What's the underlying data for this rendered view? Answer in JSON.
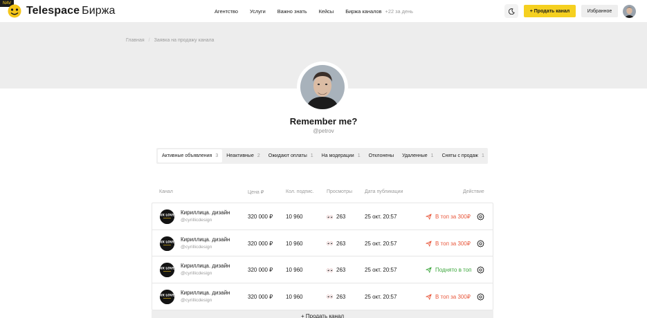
{
  "header": {
    "nav_tag": "NAV",
    "logo_main": "Telespace",
    "logo_sub": "Биржа",
    "menu": [
      "Агентство",
      "Услуги",
      "Важно знать",
      "Кейсы",
      "Биржа каналов"
    ],
    "menu_extra": "+22 за день",
    "sell_label": "+ Продать канал",
    "fav_label": "Избранное"
  },
  "breadcrumb": {
    "home": "Главная",
    "sep": "/",
    "current": "Заявка на продажу канала"
  },
  "profile": {
    "name": "Remember me?",
    "username": "@petrov"
  },
  "tabs": [
    {
      "label": "Активные объявления",
      "count": "3",
      "active": true
    },
    {
      "label": "Неактивные",
      "count": "2"
    },
    {
      "label": "Ожидают оплаты",
      "count": "1"
    },
    {
      "label": "На модерации",
      "count": "1"
    },
    {
      "label": "Отклонены",
      "count": ""
    },
    {
      "label": "Удаленные",
      "count": "1"
    },
    {
      "label": "Сняты с продаж",
      "count": "1"
    }
  ],
  "table": {
    "headers": {
      "channel": "Канал",
      "price": "Цена ₽",
      "subs": "Кол. подпис.",
      "views": "Просмотры",
      "date": "Дата публикации",
      "action": "Действие"
    },
    "rows": [
      {
        "name": "Кириллица. дизайн",
        "username": "@cyrillicdesign",
        "price": "320 000 ₽",
        "subs": "10 960",
        "views": "263",
        "date": "25 окт. 20:57",
        "action": "В топ за 300₽",
        "status": "promo"
      },
      {
        "name": "Кириллица. дизайн",
        "username": "@cyrillicdesign",
        "price": "320 000 ₽",
        "subs": "10 960",
        "views": "263",
        "date": "25 окт. 20:57",
        "action": "В топ за 300₽",
        "status": "promo"
      },
      {
        "name": "Кириллица. дизайн",
        "username": "@cyrillicdesign",
        "price": "320 000 ₽",
        "subs": "10 960",
        "views": "263",
        "date": "25 окт. 20:57",
        "action": "Поднято в топ",
        "status": "done"
      },
      {
        "name": "Кириллица. дизайн",
        "username": "@cyrillicdesign",
        "price": "320 000 ₽",
        "subs": "10 960",
        "views": "263",
        "date": "25 окт. 20:57",
        "action": "В топ за 300₽",
        "status": "promo"
      }
    ],
    "logo_text": "UX LOVE",
    "add_label": "+ Продать канал"
  },
  "colors": {
    "accent": "#f5d020",
    "promo": "#e8563a",
    "done": "#3aa53a"
  },
  "icons": {
    "logo": "smiley-logo-icon",
    "theme": "moon-icon",
    "views": "eyes-icon",
    "action": "paper-plane-icon",
    "settings": "gear-icon"
  }
}
